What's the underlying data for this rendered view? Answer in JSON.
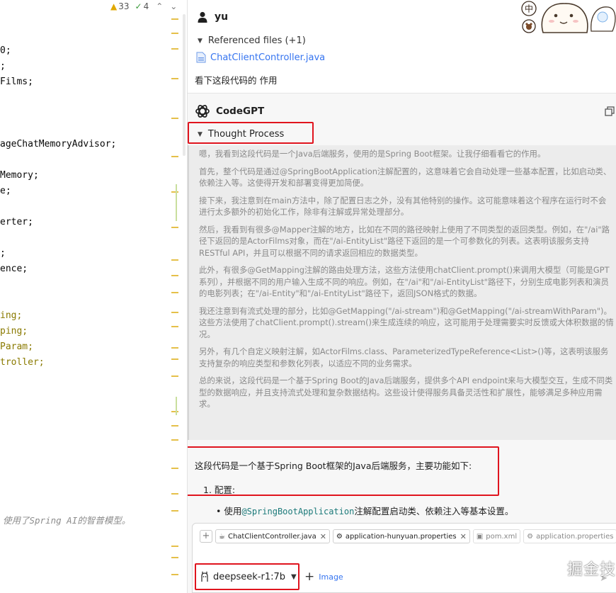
{
  "editor": {
    "warning_count": "33",
    "weak_warning_count": "4",
    "code_lines": [
      "0;",
      ";",
      "Films;",
      "ageChatMemoryAdvisor;",
      "Memory;",
      "e;",
      "erter;",
      ";",
      "ence;",
      "ing;",
      "ping;",
      "Param;",
      "troller;"
    ],
    "comment": "使用了Spring AI的智普模型。"
  },
  "chat": {
    "user": {
      "name": "yu",
      "referenced_toggle": "Referenced files (+1)",
      "referenced_file": "ChatClientController.java",
      "message": "看下这段代码的 作用"
    },
    "assistant": {
      "name": "CodeGPT",
      "thought_toggle": "Thought Process",
      "thoughts": [
        "嗯，我看到这段代码是一个Java后端服务，使用的是Spring Boot框架。让我仔细看看它的作用。",
        "首先，整个代码是通过@SpringBootApplication注解配置的，这意味着它会自动处理一些基本配置，比如启动类、依赖注入等。这使得开发和部署变得更加简便。",
        "接下来，我注意到在main方法中，除了配置日志之外，没有其他特别的操作。这可能意味着这个程序在运行时不会进行太多额外的初始化工作，除非有注解或异常处理部分。",
        "然后，我看到有很多@Mapper注解的地方，比如在不同的路径映射上使用了不同类型的返回类型。例如，在\"/ai\"路径下返回的是ActorFilms对象，而在\"/ai-EntityList\"路径下返回的是一个可参数化的列表。这表明该服务支持RESTful API，并且可以根据不同的请求返回相应的数据类型。",
        "此外，有很多@GetMapping注解的路由处理方法，这些方法使用chatClient.prompt()来调用大模型（可能是GPT系列），并根据不同的用户输入生成不同的响应。例如，在\"/ai\"和\"/ai-EntityList\"路径下，分别生成电影列表和演员的电影列表；在\"/ai-Entity\"和\"/ai-EntityList\"路径下，返回JSON格式的数据。",
        "我还注意到有流式处理的部分，比如@GetMapping(\"/ai-stream\")和@GetMapping(\"/ai-streamWithParam\")。这些方法使用了chatClient.prompt().stream()来生成连续的响应，这可能用于处理需要实时反馈或大体积数据的情况。",
        "另外，有几个自定义映射注解，如ActorFilms.class、ParameterizedTypeReference<List>()等，这表明该服务支持复杂的响应类型和参数化列表，以适应不同的业务需求。",
        "总的来说，这段代码是一个基于Spring Boot的Java后端服务，提供多个API endpoint来与大模型交互，生成不同类型的数据响应，并且支持流式处理和复杂数据结构。这些设计使得服务具备灵活性和扩展性，能够满足多种应用需求。"
      ],
      "answer_intro": "这段代码是一个基于Spring Boot框架的Java后端服务，主要功能如下:",
      "answer_item1": "1. 配置:",
      "answer_bullet_prefix": "使用",
      "answer_bullet_code": "@SpringBootApplication",
      "answer_bullet_suffix": "注解配置启动类、依赖注入等基本设置。"
    }
  },
  "input": {
    "attached_files": [
      "ChatClientController.java",
      "application-hunyuan.properties",
      "pom.xml",
      "application.properties"
    ],
    "model": "deepseek-r1:7b",
    "image_button": "Image"
  },
  "watermark": "掘金技术社区 @ 努力的小雨",
  "colors": {
    "highlight_red": "#e0141e",
    "link_blue": "#3574f0",
    "thought_text": "#8a8a8a"
  }
}
